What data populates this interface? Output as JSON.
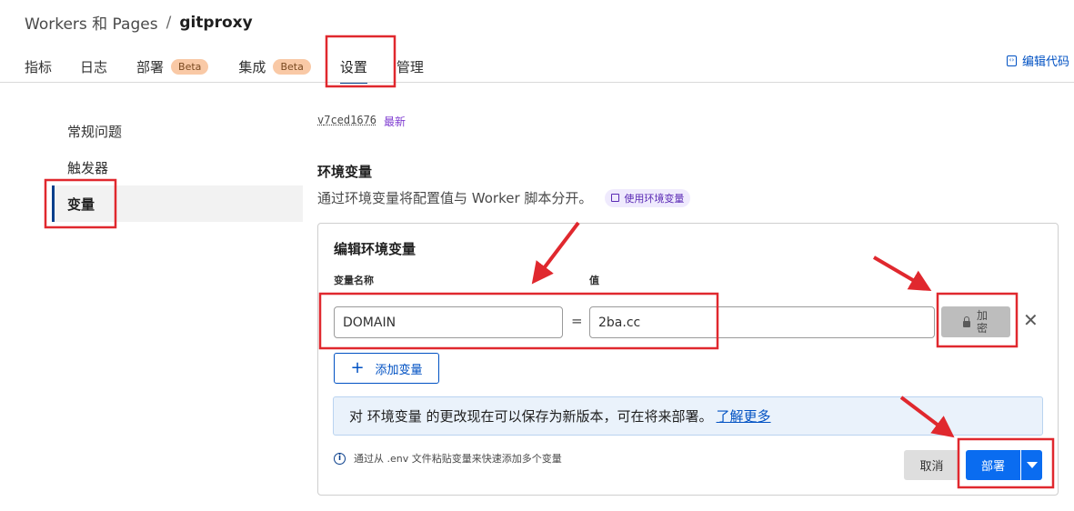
{
  "breadcrumb": {
    "parent": "Workers 和 Pages",
    "separator": "/",
    "current": "gitproxy"
  },
  "tabs": [
    {
      "label": "指标",
      "badge": ""
    },
    {
      "label": "日志",
      "badge": ""
    },
    {
      "label": "部署",
      "badge": "Beta"
    },
    {
      "label": "集成",
      "badge": "Beta"
    },
    {
      "label": "设置",
      "badge": ""
    },
    {
      "label": "管理",
      "badge": ""
    }
  ],
  "active_tab": "设置",
  "edit_code_label": "编辑代码",
  "sidebar": {
    "items": [
      {
        "label": "常规问题"
      },
      {
        "label": "触发器"
      },
      {
        "label": "变量"
      }
    ],
    "active": "变量"
  },
  "version": {
    "prefix": "v",
    "id": "7ced1676",
    "status": "最新"
  },
  "section": {
    "title": "环境变量",
    "description": "通过环境变量将配置值与 Worker 脚本分开。",
    "doc_link": "使用环境变量"
  },
  "editor": {
    "title": "编辑环境变量",
    "col_name_label": "变量名称",
    "col_value_label": "值",
    "rows": [
      {
        "name": "DOMAIN",
        "equals": "=",
        "value": "2ba.cc",
        "encrypt_label": "加密"
      }
    ],
    "add_label": "添加变量",
    "notice": {
      "text": "对 环境变量 的更改现在可以保存为新版本，可在将来部署。",
      "link": "了解更多"
    },
    "hint": "通过从 .env 文件粘贴变量来快速添加多个变量",
    "cancel_label": "取消",
    "deploy_label": "部署"
  },
  "colors": {
    "accent": "#0051c3",
    "primary_button": "#0a6cf0",
    "annotation": "#e0282e",
    "beta_badge": "#f9c9a6"
  }
}
